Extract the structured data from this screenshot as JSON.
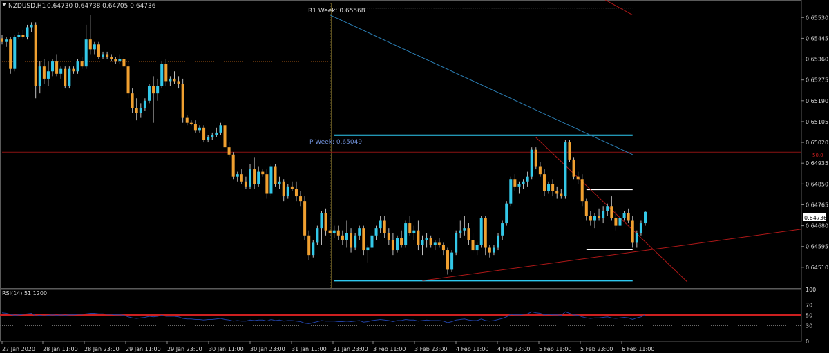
{
  "header": {
    "symbol": "NZDUSD,H1",
    "ohlc": "0.64730 0.64738 0.64705 0.64736"
  },
  "colors": {
    "background": "#000000",
    "bull": "#33c8e8",
    "bear": "#f0a030",
    "level": "#2ec8f0",
    "white_level": "#ffffff",
    "red": "#cc1f1f",
    "blue_trend": "#2b7fb5",
    "grid": "#3a3a3a",
    "text": "#d8d8d8",
    "rsi": "#2040a0",
    "label_blue": "#6f8fd6"
  },
  "annotations": {
    "r1_label": "R1 Week: 0.65568",
    "p_label": "P Week: 0.65049",
    "red_level_label": "50.0",
    "last_price": "0.64736"
  },
  "chart_data": [
    {
      "type": "candlestick",
      "title": "",
      "price_axis": {
        "ylim": [
          0.64425,
          0.6559
        ],
        "ticks": [
          "0.65530",
          "0.65445",
          "0.65360",
          "0.65275",
          "0.65190",
          "0.65105",
          "0.65020",
          "0.64935",
          "0.64850",
          "0.64765",
          "0.64680",
          "0.64595",
          "0.64510"
        ]
      },
      "time_axis": {
        "ticks": [
          "27 Jan 2020",
          "28 Jan 11:00",
          "28 Jan 23:00",
          "29 Jan 11:00",
          "29 Jan 23:00",
          "30 Jan 11:00",
          "30 Jan 23:00",
          "31 Jan 11:00",
          "31 Jan 23:00",
          "3 Feb 11:00",
          "3 Feb 23:00",
          "4 Feb 11:00",
          "4 Feb 23:00",
          "5 Feb 11:00",
          "5 Feb 23:00",
          "6 Feb 11:00"
        ]
      },
      "levels": [
        {
          "label": "R1 Week: 0.65568",
          "price": 0.65568,
          "from_bar": 78,
          "to_bar": 150
        },
        {
          "label": "P Week: 0.65049",
          "price": 0.65049,
          "from_bar": 79,
          "to_bar": 150
        },
        {
          "price": 0.64455,
          "from_bar": 79,
          "to_bar": 150
        },
        {
          "price": 0.64828,
          "from_bar": 139,
          "to_bar": 150
        },
        {
          "price": 0.64583,
          "from_bar": 139,
          "to_bar": 150
        },
        {
          "price": 0.6498,
          "from_bar": 0,
          "to_bar": 197
        },
        {
          "price": 0.6535,
          "from_bar": 0,
          "to_bar": 78
        }
      ],
      "trendlines": [
        {
          "color": "blue",
          "from": {
            "bar": 78,
            "price": 0.6554
          },
          "to": {
            "bar": 150,
            "price": 0.6497
          }
        },
        {
          "color": "red",
          "from": {
            "bar": 100,
            "price": 0.64455
          },
          "to": {
            "bar": 190,
            "price": 0.64665
          }
        },
        {
          "color": "red",
          "from": {
            "bar": 127,
            "price": 0.6504
          },
          "to": {
            "bar": 163,
            "price": 0.6445
          }
        },
        {
          "color": "red",
          "from": {
            "bar": 131,
            "price": 0.6572
          },
          "to": {
            "bar": 150,
            "price": 0.6554
          }
        }
      ],
      "candles_ohlc": [
        [
          0.65445,
          0.6546,
          0.6542,
          0.6543
        ],
        [
          0.6543,
          0.6545,
          0.6541,
          0.6544
        ],
        [
          0.6544,
          0.6545,
          0.653,
          0.6532
        ],
        [
          0.6532,
          0.6546,
          0.6531,
          0.6545
        ],
        [
          0.6545,
          0.6547,
          0.6544,
          0.6546
        ],
        [
          0.6546,
          0.6548,
          0.6544,
          0.6545
        ],
        [
          0.6545,
          0.655,
          0.6544,
          0.6549
        ],
        [
          0.6549,
          0.6551,
          0.6547,
          0.655
        ],
        [
          0.655,
          0.6551,
          0.652,
          0.6525
        ],
        [
          0.6525,
          0.6535,
          0.6522,
          0.6533
        ],
        [
          0.6533,
          0.6536,
          0.6526,
          0.6528
        ],
        [
          0.6528,
          0.6535,
          0.6525,
          0.6531
        ],
        [
          0.6531,
          0.6536,
          0.6529,
          0.6535
        ],
        [
          0.6535,
          0.6538,
          0.6529,
          0.653
        ],
        [
          0.653,
          0.6533,
          0.6528,
          0.6532
        ],
        [
          0.6532,
          0.6533,
          0.6524,
          0.6525
        ],
        [
          0.6525,
          0.6533,
          0.6524,
          0.6532
        ],
        [
          0.6532,
          0.6533,
          0.653,
          0.6531
        ],
        [
          0.6531,
          0.6536,
          0.653,
          0.6535
        ],
        [
          0.6535,
          0.6537,
          0.6532,
          0.6533
        ],
        [
          0.6533,
          0.655,
          0.6532,
          0.6544
        ],
        [
          0.6544,
          0.6554,
          0.6538,
          0.654
        ],
        [
          0.654,
          0.6543,
          0.6538,
          0.6542
        ],
        [
          0.6542,
          0.6543,
          0.6536,
          0.6537
        ],
        [
          0.6537,
          0.6539,
          0.6536,
          0.6538
        ],
        [
          0.6538,
          0.6539,
          0.6536,
          0.6537
        ],
        [
          0.6537,
          0.6538,
          0.6535,
          0.6536
        ],
        [
          0.6536,
          0.6537,
          0.6534,
          0.6535
        ],
        [
          0.6535,
          0.6538,
          0.6534,
          0.6536
        ],
        [
          0.6536,
          0.6537,
          0.6532,
          0.6533
        ],
        [
          0.6533,
          0.6535,
          0.652,
          0.6522
        ],
        [
          0.6522,
          0.6524,
          0.6514,
          0.6516
        ],
        [
          0.6516,
          0.652,
          0.6511,
          0.6514
        ],
        [
          0.6514,
          0.6518,
          0.6512,
          0.6516
        ],
        [
          0.6516,
          0.652,
          0.6515,
          0.6519
        ],
        [
          0.6519,
          0.6526,
          0.6518,
          0.6525
        ],
        [
          0.6525,
          0.6529,
          0.651,
          0.6522
        ],
        [
          0.6522,
          0.6528,
          0.6519,
          0.6525
        ],
        [
          0.6525,
          0.6535,
          0.6524,
          0.6534
        ],
        [
          0.6534,
          0.6536,
          0.6525,
          0.6527
        ],
        [
          0.6527,
          0.6529,
          0.6525,
          0.6528
        ],
        [
          0.6528,
          0.6531,
          0.6526,
          0.6527
        ],
        [
          0.6527,
          0.6529,
          0.6524,
          0.6526
        ],
        [
          0.6526,
          0.6528,
          0.651,
          0.6512
        ],
        [
          0.6512,
          0.6513,
          0.6509,
          0.651
        ],
        [
          0.651,
          0.6511,
          0.6509,
          0.65095
        ],
        [
          0.65095,
          0.6511,
          0.6506,
          0.6507
        ],
        [
          0.6507,
          0.6509,
          0.6506,
          0.6508
        ],
        [
          0.6508,
          0.6509,
          0.6502,
          0.6503
        ],
        [
          0.6503,
          0.6505,
          0.6502,
          0.6504
        ],
        [
          0.6504,
          0.6506,
          0.6503,
          0.6505
        ],
        [
          0.6505,
          0.6508,
          0.6504,
          0.6506
        ],
        [
          0.6506,
          0.651,
          0.6505,
          0.6509
        ],
        [
          0.6509,
          0.651,
          0.6499,
          0.65
        ],
        [
          0.65,
          0.6502,
          0.6496,
          0.6497
        ],
        [
          0.6497,
          0.6498,
          0.6487,
          0.6488
        ],
        [
          0.6488,
          0.649,
          0.6486,
          0.6489
        ],
        [
          0.6489,
          0.6491,
          0.6485,
          0.6486
        ],
        [
          0.6486,
          0.6488,
          0.6483,
          0.6484
        ],
        [
          0.6484,
          0.6493,
          0.6483,
          0.6491
        ],
        [
          0.6491,
          0.6496,
          0.6483,
          0.6485
        ],
        [
          0.6485,
          0.6492,
          0.6484,
          0.649
        ],
        [
          0.649,
          0.6491,
          0.6488,
          0.6489
        ],
        [
          0.6489,
          0.6491,
          0.6479,
          0.6481
        ],
        [
          0.6481,
          0.6493,
          0.648,
          0.6492
        ],
        [
          0.6492,
          0.6493,
          0.6484,
          0.6485
        ],
        [
          0.6485,
          0.6488,
          0.6483,
          0.6486
        ],
        [
          0.6486,
          0.6487,
          0.6478,
          0.648
        ],
        [
          0.648,
          0.6485,
          0.6479,
          0.6484
        ],
        [
          0.6484,
          0.6486,
          0.6482,
          0.6483
        ],
        [
          0.6483,
          0.6486,
          0.6478,
          0.648
        ],
        [
          0.648,
          0.6482,
          0.6476,
          0.6478
        ],
        [
          0.6478,
          0.648,
          0.6462,
          0.6464
        ],
        [
          0.6464,
          0.6466,
          0.6454,
          0.6456
        ],
        [
          0.6456,
          0.6462,
          0.6455,
          0.6461
        ],
        [
          0.6461,
          0.6468,
          0.646,
          0.6467
        ],
        [
          0.6467,
          0.6474,
          0.646,
          0.6473
        ],
        [
          0.6473,
          0.6475,
          0.6464,
          0.6466
        ],
        [
          0.6466,
          0.6472,
          0.6464,
          0.6465
        ],
        [
          0.6465,
          0.6468,
          0.6463,
          0.6466
        ],
        [
          0.6466,
          0.6468,
          0.6462,
          0.6464
        ],
        [
          0.6464,
          0.6466,
          0.646,
          0.6462
        ],
        [
          0.6462,
          0.647,
          0.6459,
          0.6465
        ],
        [
          0.6465,
          0.6467,
          0.6457,
          0.6459
        ],
        [
          0.6459,
          0.6465,
          0.6458,
          0.6464
        ],
        [
          0.6464,
          0.6468,
          0.6462,
          0.6467
        ],
        [
          0.6467,
          0.6468,
          0.6456,
          0.6458
        ],
        [
          0.6458,
          0.646,
          0.6453,
          0.6459
        ],
        [
          0.6459,
          0.6465,
          0.6458,
          0.6464
        ],
        [
          0.6464,
          0.6468,
          0.6462,
          0.6467
        ],
        [
          0.6467,
          0.6472,
          0.6465,
          0.647
        ],
        [
          0.647,
          0.6472,
          0.6463,
          0.6465
        ],
        [
          0.6465,
          0.6467,
          0.646,
          0.6462
        ],
        [
          0.6462,
          0.6465,
          0.6456,
          0.6458
        ],
        [
          0.6458,
          0.6464,
          0.6457,
          0.6463
        ],
        [
          0.6463,
          0.6466,
          0.6459,
          0.646
        ],
        [
          0.646,
          0.647,
          0.6459,
          0.6469
        ],
        [
          0.6469,
          0.6472,
          0.6464,
          0.6465
        ],
        [
          0.6465,
          0.6468,
          0.6462,
          0.6466
        ],
        [
          0.6466,
          0.647,
          0.6458,
          0.646
        ],
        [
          0.646,
          0.6464,
          0.6456,
          0.6462
        ],
        [
          0.6462,
          0.6465,
          0.6459,
          0.6463
        ],
        [
          0.6463,
          0.6464,
          0.6459,
          0.646
        ],
        [
          0.646,
          0.6462,
          0.6458,
          0.6461
        ],
        [
          0.6461,
          0.6463,
          0.6459,
          0.646
        ],
        [
          0.646,
          0.6461,
          0.6456,
          0.6458
        ],
        [
          0.6458,
          0.6459,
          0.6448,
          0.645
        ],
        [
          0.645,
          0.6458,
          0.6449,
          0.6457
        ],
        [
          0.6457,
          0.6466,
          0.6456,
          0.6465
        ],
        [
          0.6465,
          0.647,
          0.6463,
          0.6466
        ],
        [
          0.6466,
          0.6472,
          0.6464,
          0.6467
        ],
        [
          0.6467,
          0.6469,
          0.646,
          0.6462
        ],
        [
          0.6462,
          0.6465,
          0.6457,
          0.6458
        ],
        [
          0.6458,
          0.6461,
          0.6456,
          0.646
        ],
        [
          0.646,
          0.6472,
          0.6459,
          0.6471
        ],
        [
          0.6471,
          0.6472,
          0.6456,
          0.6459
        ],
        [
          0.6459,
          0.646,
          0.6455,
          0.6457
        ],
        [
          0.6457,
          0.646,
          0.6456,
          0.6459
        ],
        [
          0.6459,
          0.6465,
          0.6458,
          0.6464
        ],
        [
          0.6464,
          0.647,
          0.6462,
          0.6469
        ],
        [
          0.6469,
          0.6478,
          0.6468,
          0.6477
        ],
        [
          0.6477,
          0.6488,
          0.6476,
          0.6487
        ],
        [
          0.6487,
          0.6489,
          0.6482,
          0.6484
        ],
        [
          0.6484,
          0.6486,
          0.6481,
          0.6485
        ],
        [
          0.6485,
          0.6487,
          0.6483,
          0.6486
        ],
        [
          0.6486,
          0.649,
          0.6484,
          0.6488
        ],
        [
          0.6488,
          0.65,
          0.6487,
          0.6499
        ],
        [
          0.6499,
          0.65,
          0.6491,
          0.6492
        ],
        [
          0.6492,
          0.6494,
          0.6488,
          0.6489
        ],
        [
          0.6489,
          0.6491,
          0.648,
          0.6482
        ],
        [
          0.6482,
          0.6486,
          0.6481,
          0.6485
        ],
        [
          0.6485,
          0.6487,
          0.648,
          0.6482
        ],
        [
          0.6482,
          0.6484,
          0.6479,
          0.6481
        ],
        [
          0.6481,
          0.6483,
          0.6479,
          0.648
        ],
        [
          0.648,
          0.6503,
          0.6479,
          0.6502
        ],
        [
          0.6502,
          0.6503,
          0.6494,
          0.6495
        ],
        [
          0.6495,
          0.6496,
          0.6487,
          0.6488
        ],
        [
          0.6488,
          0.649,
          0.6485,
          0.6487
        ],
        [
          0.6487,
          0.6489,
          0.6476,
          0.6478
        ],
        [
          0.6478,
          0.6479,
          0.647,
          0.6472
        ],
        [
          0.6472,
          0.6474,
          0.6468,
          0.647
        ],
        [
          0.647,
          0.6473,
          0.6467,
          0.6472
        ],
        [
          0.6472,
          0.6475,
          0.647,
          0.6471
        ],
        [
          0.6471,
          0.6476,
          0.6469,
          0.6474
        ],
        [
          0.6474,
          0.6477,
          0.6472,
          0.6476
        ],
        [
          0.6476,
          0.648,
          0.647,
          0.6471
        ],
        [
          0.6471,
          0.6474,
          0.6466,
          0.6468
        ],
        [
          0.6468,
          0.6472,
          0.6467,
          0.6471
        ],
        [
          0.6471,
          0.6474,
          0.647,
          0.6473
        ],
        [
          0.6473,
          0.6475,
          0.6469,
          0.647
        ],
        [
          0.647,
          0.6472,
          0.6459,
          0.6461
        ],
        [
          0.6461,
          0.6466,
          0.6459,
          0.6465
        ],
        [
          0.6465,
          0.647,
          0.6464,
          0.6469
        ],
        [
          0.6469,
          0.6474,
          0.6468,
          0.64736
        ]
      ]
    },
    {
      "type": "line",
      "title": "RSI(14) 51.1200",
      "ylim": [
        0,
        100
      ],
      "ticks": [
        "100",
        "70",
        "50",
        "30",
        "0"
      ],
      "reference_levels": [
        70,
        50,
        30
      ],
      "values": [
        55,
        54,
        52,
        50,
        51,
        52,
        53,
        54,
        49,
        50,
        49,
        50,
        51,
        50,
        51,
        50,
        51,
        51,
        52,
        52,
        53,
        54,
        54,
        53,
        53,
        52,
        52,
        51,
        51,
        50,
        47,
        45,
        44,
        45,
        46,
        48,
        47,
        48,
        50,
        48,
        48,
        48,
        47,
        44,
        43,
        43,
        42,
        42,
        41,
        42,
        42,
        43,
        44,
        42,
        41,
        39,
        40,
        39,
        39,
        41,
        40,
        41,
        41,
        39,
        42,
        40,
        41,
        39,
        40,
        40,
        39,
        38,
        35,
        34,
        36,
        38,
        40,
        39,
        39,
        39,
        38,
        38,
        39,
        38,
        39,
        40,
        37,
        38,
        40,
        41,
        42,
        41,
        40,
        38,
        40,
        40,
        42,
        41,
        41,
        39,
        40,
        41,
        40,
        40,
        40,
        39,
        36,
        38,
        41,
        42,
        43,
        41,
        40,
        40,
        43,
        40,
        39,
        40,
        42,
        44,
        47,
        52,
        51,
        51,
        52,
        53,
        57,
        55,
        54,
        51,
        52,
        51,
        51,
        50,
        57,
        54,
        51,
        50,
        47,
        45,
        44,
        45,
        45,
        46,
        47,
        45,
        44,
        45,
        46,
        45,
        42,
        45,
        47,
        51
      ]
    }
  ]
}
